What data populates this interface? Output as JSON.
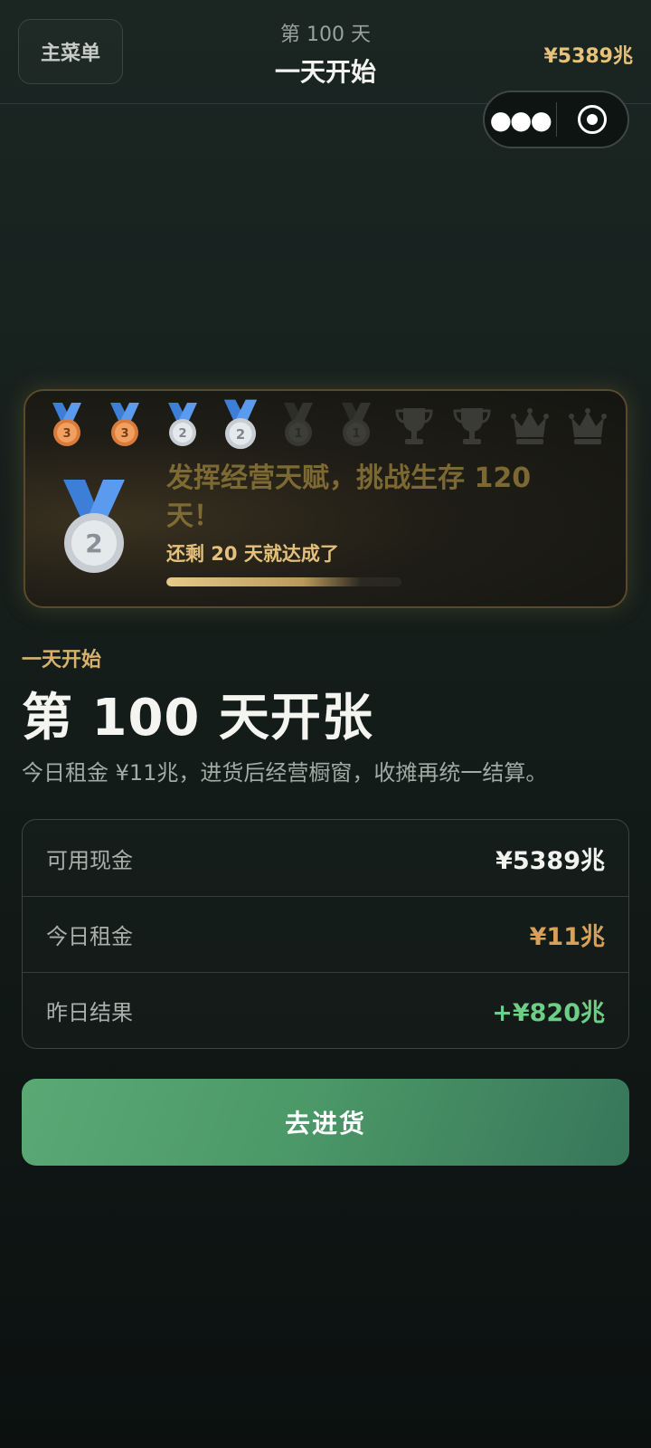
{
  "header": {
    "menu_label": "主菜单",
    "day_label": "第 100 天",
    "title": "一天开始",
    "cash": "¥5389兆"
  },
  "capsule": {
    "more_icon": "more-dots-icon",
    "close_icon": "target-close-icon"
  },
  "achievement": {
    "medals": [
      {
        "icon": "bronze-medal-icon",
        "number": "3",
        "state": "earned"
      },
      {
        "icon": "bronze-medal-icon",
        "number": "3",
        "state": "earned"
      },
      {
        "icon": "silver-medal-icon",
        "number": "2",
        "state": "earned"
      },
      {
        "icon": "silver-medal-icon",
        "number": "2",
        "state": "current"
      },
      {
        "icon": "gold-medal-icon",
        "number": "1",
        "state": "locked"
      },
      {
        "icon": "gold-medal-icon",
        "number": "1",
        "state": "locked"
      },
      {
        "icon": "trophy-icon",
        "state": "locked"
      },
      {
        "icon": "trophy-icon",
        "state": "locked"
      },
      {
        "icon": "crown-icon",
        "state": "locked"
      },
      {
        "icon": "crown-icon",
        "state": "locked"
      }
    ],
    "big_medal": {
      "icon": "silver-medal-icon",
      "number": "2"
    },
    "title": "发挥经营天赋，挑战生存 120 天！",
    "subtitle": "还剩 20 天就达成了",
    "progress": 0.83
  },
  "main": {
    "section_label": "一天开始",
    "headline": "第 100 天开张",
    "description": "今日租金 ¥11兆，进货后经营橱窗，收摊再统一结算。"
  },
  "stats": [
    {
      "label": "可用现金",
      "value": "¥5389兆",
      "color": "#f2f3ef"
    },
    {
      "label": "今日租金",
      "value": "¥11兆",
      "color": "#d9a05a"
    },
    {
      "label": "昨日结果",
      "value": "+¥820兆",
      "color": "#6ccf86"
    }
  ],
  "cta_label": "去进货"
}
